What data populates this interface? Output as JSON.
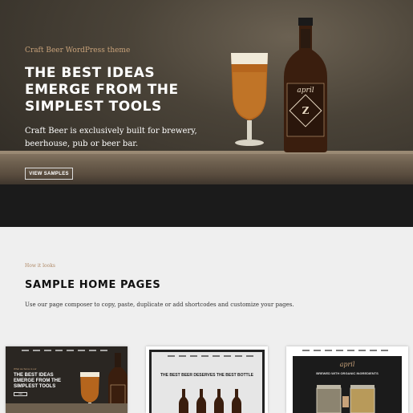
{
  "hero": {
    "kicker": "Craft Beer WordPress theme",
    "title": "THE BEST IDEAS EMERGE FROM THE SIMPLEST TOOLS",
    "description": "Craft Beer is exclusively built for brewery, beerhouse, pub or beer bar.",
    "button_label": "VIEW SAMPLES",
    "bottle_label": "april"
  },
  "samples": {
    "kicker": "How it looks",
    "title": "SAMPLE HOME PAGES",
    "description": "Use our page composer to copy, paste, duplicate or add shortcodes and customize your pages."
  },
  "cards": [
    {
      "title": "THE BEST IDEAS EMERGE FROM THE SIMPLEST TOOLS",
      "kicker": "What we Serve is our",
      "button": "VIEW"
    },
    {
      "title": "THE BEST BEER DESERVES THE BEST BOTTLE"
    },
    {
      "logo": "april",
      "title": "BREWED WITH ORGANIC INGREDIENTS"
    }
  ],
  "colors": {
    "accent": "#c8a27a",
    "dark_band": "#1b1b1b",
    "background": "#efefef"
  }
}
